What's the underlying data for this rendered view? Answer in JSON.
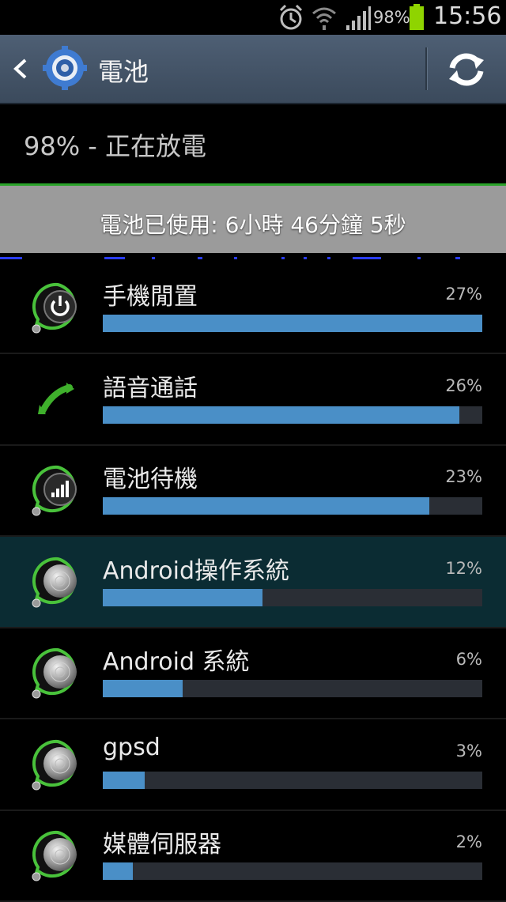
{
  "status_bar": {
    "battery_percent": "98%",
    "clock": "15:56",
    "icons": [
      "alarm-icon",
      "wifi-icon",
      "signal-icon",
      "battery-icon"
    ],
    "battery_color": "#8fd400"
  },
  "action_bar": {
    "title": "電池",
    "icons": [
      "back-icon",
      "settings-gear-icon",
      "refresh-icon"
    ],
    "background_color": "#4e5f74"
  },
  "battery": {
    "status_line": "98% - 正在放電",
    "usage_text": "電池已使用: 6小時 46分鐘 5秒",
    "accent_color": "#2aa32a"
  },
  "usage_list": [
    {
      "label": "手機閒置",
      "percent": "27%",
      "level": 1.0,
      "icon": "power-icon",
      "selected": false
    },
    {
      "label": "語音通話",
      "percent": "26%",
      "level": 0.94,
      "icon": "phone-call-icon",
      "selected": false
    },
    {
      "label": "電池待機",
      "percent": "23%",
      "level": 0.86,
      "icon": "cell-signal-icon",
      "selected": false
    },
    {
      "label": "Android操作系統",
      "percent": "12%",
      "level": 0.42,
      "icon": "android-os-icon",
      "selected": true
    },
    {
      "label": "Android 系統",
      "percent": "6%",
      "level": 0.21,
      "icon": "android-system-icon",
      "selected": false
    },
    {
      "label": "gpsd",
      "percent": "3%",
      "level": 0.11,
      "icon": "gpsd-icon",
      "selected": false
    },
    {
      "label": "媒體伺服器",
      "percent": "2%",
      "level": 0.08,
      "icon": "media-server-icon",
      "selected": false
    }
  ],
  "colors": {
    "bar_fill": "#4a8fc7",
    "bar_track": "#2a2e35",
    "selected_row": "#0b2c33"
  }
}
